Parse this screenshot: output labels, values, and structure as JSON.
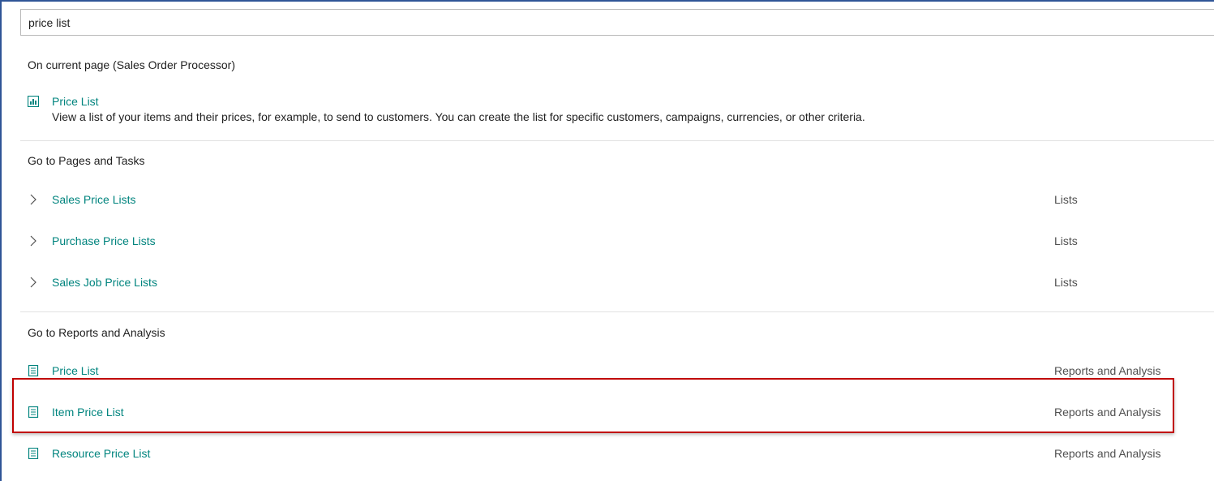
{
  "search": {
    "value": "price list"
  },
  "current_page": {
    "title": "On current page (Sales Order Processor)",
    "item": {
      "label": "Price List",
      "icon": "chart-report-icon",
      "description": "View a list of your items and their prices, for example, to send to customers. You can create the list for specific customers, campaigns, currencies, or other criteria."
    }
  },
  "pages_tasks": {
    "title": "Go to Pages and Tasks",
    "items": [
      {
        "label": "Sales Price Lists",
        "category": "Lists",
        "icon": "chevron-right-icon"
      },
      {
        "label": "Purchase Price Lists",
        "category": "Lists",
        "icon": "chevron-right-icon"
      },
      {
        "label": "Sales Job Price Lists",
        "category": "Lists",
        "icon": "chevron-right-icon"
      }
    ]
  },
  "reports": {
    "title": "Go to Reports and Analysis",
    "items": [
      {
        "label": "Price List",
        "category": "Reports and Analysis",
        "icon": "report-document-icon"
      },
      {
        "label": "Item Price List",
        "category": "Reports and Analysis",
        "icon": "report-document-icon"
      },
      {
        "label": "Resource Price List",
        "category": "Reports and Analysis",
        "icon": "report-document-icon"
      }
    ]
  },
  "colors": {
    "link": "#00847e",
    "highlight": "#c00000",
    "frame": "#2f5597"
  }
}
